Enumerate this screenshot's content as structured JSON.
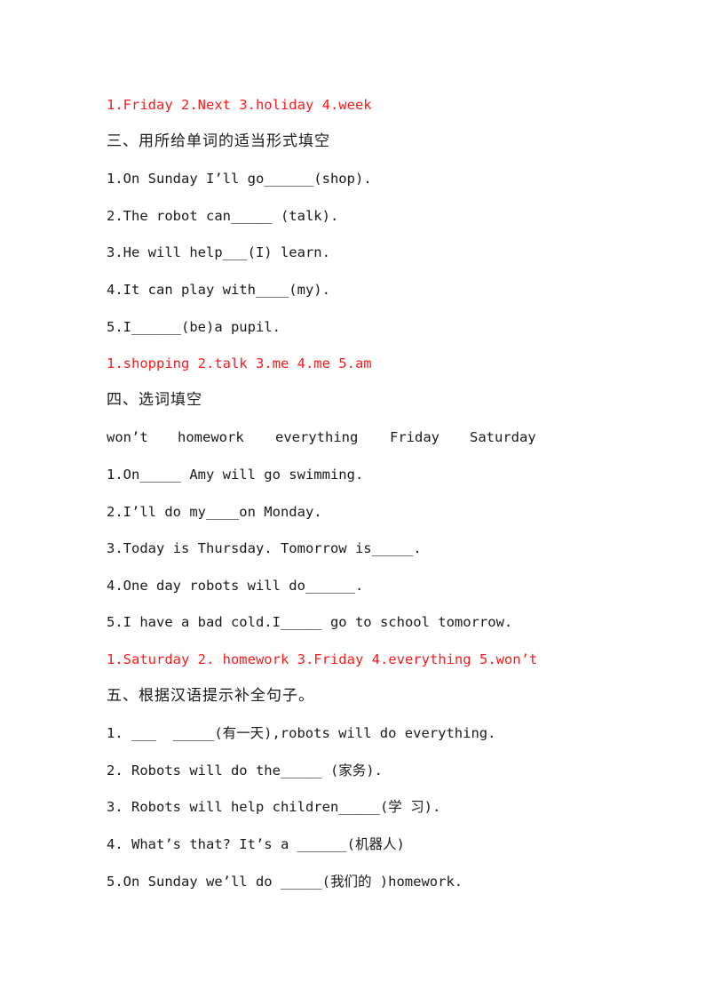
{
  "answer_section_2": "1.Friday 2.Next 3.holiday 4.week",
  "section_3": {
    "title": "三、用所给单词的适当形式填空",
    "questions": [
      "1.On Sunday I’ll go______(shop).",
      "2.The robot can_____ (talk).",
      "3.He will help___(I) learn.",
      "4.It can play with____(my).",
      "5.I______(be)a pupil."
    ],
    "answers": "1.shopping 2.talk 3.me 4.me 5.am"
  },
  "section_4": {
    "title": "四、选词填空",
    "word_bank": [
      "won’t",
      "homework",
      "everything",
      "Friday",
      "Saturday"
    ],
    "questions": [
      "1.On_____ Amy will go swimming.",
      "2.I’ll do my____on Monday.",
      "3.Today is Thursday. Tomorrow is_____.",
      "4.One day robots will do______.",
      "5.I have a bad cold.I_____ go to school tomorrow."
    ],
    "answers": "1.Saturday 2. homework 3.Friday 4.everything 5.won’t"
  },
  "section_5": {
    "title": "五、根据汉语提示补全句子。",
    "questions": [
      "1. ___  _____(有一天),robots will do everything.",
      "2. Robots will do the_____ (家务).",
      "3. Robots will help children_____(学 习).",
      "4. What’s that? It’s a ______(机器人)",
      "5.On Sunday we’ll do _____(我们的 )homework."
    ]
  },
  "colors": {
    "text": "#1a1a1a",
    "answer": "#ff1a1a"
  }
}
